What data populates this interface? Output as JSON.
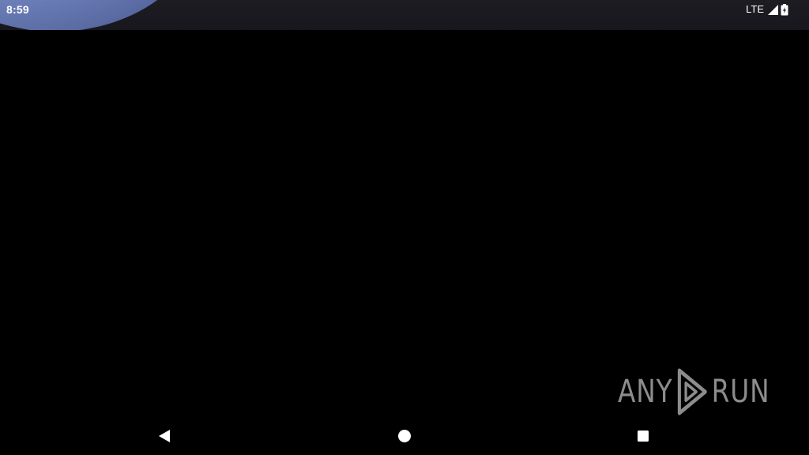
{
  "status_bar": {
    "time": "8:59",
    "network_type": "LTE",
    "icons": [
      "signal-icon",
      "battery-icon"
    ]
  },
  "watermark": {
    "left_text": "ANY",
    "right_text": "RUN",
    "icon": "play-triangle-icon"
  },
  "nav_bar": {
    "buttons": [
      "back-icon",
      "home-icon",
      "recents-icon"
    ]
  },
  "colors": {
    "background": "#000000",
    "status_bar": "#1c1c22",
    "wallpaper_accent": "#7488c2",
    "watermark": "#8c8c8c",
    "nav_icons": "#ffffff"
  }
}
